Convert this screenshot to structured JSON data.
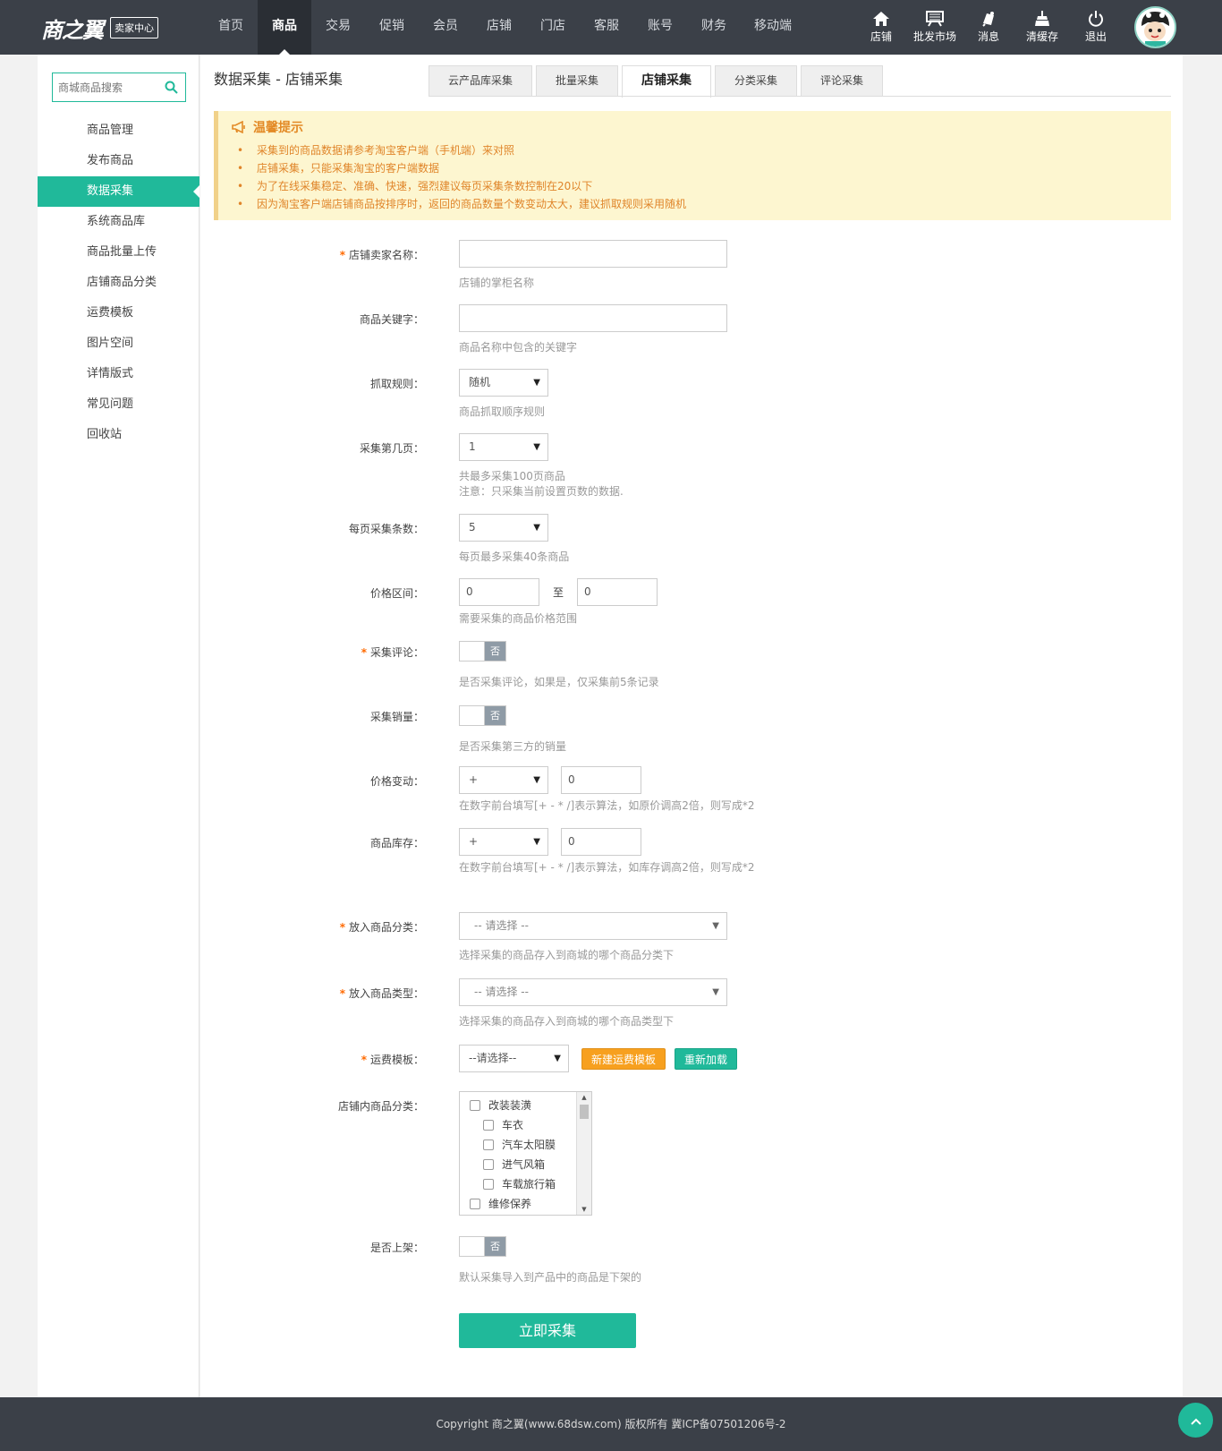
{
  "header": {
    "logo_text": "商之翼",
    "logo_badge": "卖家中心",
    "nav": [
      "首页",
      "商品",
      "交易",
      "促销",
      "会员",
      "店铺",
      "门店",
      "客服",
      "账号",
      "财务",
      "移动端"
    ],
    "tools": [
      {
        "label": "店铺",
        "icon": "home-icon"
      },
      {
        "label": "批发市场",
        "icon": "market-icon"
      },
      {
        "label": "消息",
        "icon": "bell-icon"
      },
      {
        "label": "清缓存",
        "icon": "broom-icon"
      },
      {
        "label": "退出",
        "icon": "power-icon"
      }
    ]
  },
  "sidebar": {
    "search_placeholder": "商城商品搜索",
    "items": [
      "商品管理",
      "发布商品",
      "数据采集",
      "系统商品库",
      "商品批量上传",
      "店铺商品分类",
      "运费模板",
      "图片空间",
      "详情版式",
      "常见问题",
      "回收站"
    ]
  },
  "main": {
    "title": "数据采集 - 店铺采集",
    "tabs": [
      "云产品库采集",
      "批量采集",
      "店铺采集",
      "分类采集",
      "评论采集"
    ],
    "notice": {
      "title": "温馨提示",
      "items": [
        "采集到的商品数据请参考淘宝客户端（手机端）来对照",
        "店铺采集，只能采集淘宝的客户端数据",
        "为了在线采集稳定、准确、快速，强烈建议每页采集条数控制在20以下",
        "因为淘宝客户端店铺商品按排序时，返回的商品数量个数变动太大，建议抓取规则采用随机"
      ]
    },
    "form": {
      "seller_name": {
        "label": "店铺卖家名称：",
        "hint": "店铺的掌柜名称"
      },
      "keyword": {
        "label": "商品关键字：",
        "hint": "商品名称中包含的关键字"
      },
      "rule": {
        "label": "抓取规则：",
        "value": "随机",
        "hint": "商品抓取顺序规则"
      },
      "page": {
        "label": "采集第几页：",
        "value": "1",
        "hint1": "共最多采集100页商品",
        "hint2": "注意：只采集当前设置页数的数据."
      },
      "per_page": {
        "label": "每页采集条数：",
        "value": "5",
        "hint": "每页最多采集40条商品"
      },
      "price_range": {
        "label": "价格区间：",
        "min": "0",
        "to": "至",
        "max": "0",
        "hint": "需要采集的商品价格范围"
      },
      "comment": {
        "label": "采集评论：",
        "value": "否",
        "hint": "是否采集评论，如果是，仅采集前5条记录"
      },
      "sales": {
        "label": "采集销量：",
        "value": "否",
        "hint": "是否采集第三方的销量"
      },
      "price_change": {
        "label": "价格变动：",
        "op": "+",
        "value": "0",
        "hint": "在数字前台填写[+ - * /]表示算法，如原价调高2倍，则写成*2"
      },
      "stock": {
        "label": "商品库存：",
        "op": "+",
        "value": "0",
        "hint": "在数字前台填写[+ - * /]表示算法，如库存调高2倍，则写成*2"
      },
      "category": {
        "label": "放入商品分类：",
        "value": "-- 请选择 --",
        "hint": "选择采集的商品存入到商城的哪个商品分类下"
      },
      "type": {
        "label": "放入商品类型：",
        "value": "-- 请选择 --",
        "hint": "选择采集的商品存入到商城的哪个商品类型下"
      },
      "shipping": {
        "label": "运费模板：",
        "value": "--请选择--",
        "btn_new": "新建运费模板",
        "btn_reload": "重新加载"
      },
      "shop_category": {
        "label": "店铺内商品分类：",
        "items": [
          {
            "text": "改装装潢",
            "level": 0
          },
          {
            "text": "车衣",
            "level": 1
          },
          {
            "text": "汽车太阳膜",
            "level": 1
          },
          {
            "text": "进气风箱",
            "level": 1
          },
          {
            "text": "车载旅行箱",
            "level": 1
          },
          {
            "text": "维修保养",
            "level": 0
          }
        ]
      },
      "on_sale": {
        "label": "是否上架：",
        "value": "否",
        "hint": "默认采集导入到产品中的商品是下架的"
      },
      "submit": "立即采集"
    }
  },
  "footer": {
    "text": "Copyright 商之翼(www.68dsw.com) 版权所有   冀ICP备07501206号-2"
  },
  "colors": {
    "accent": "#20b99a",
    "header_bg": "#3b4048",
    "notice_bg": "#fdf6d0",
    "notice_text": "#e0852a",
    "orange": "#f7a01f"
  }
}
